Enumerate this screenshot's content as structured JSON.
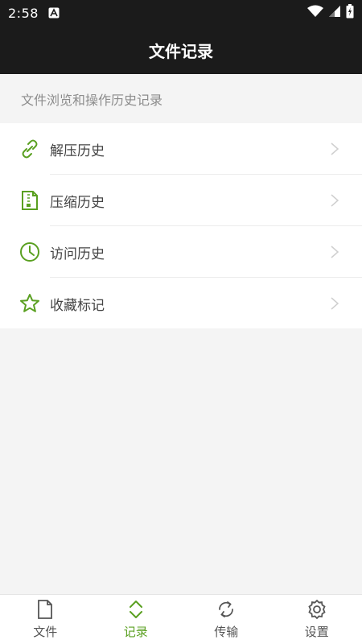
{
  "status_bar": {
    "time": "2:58",
    "notification_icon": "notification-a-icon",
    "wifi_icon": "wifi-icon",
    "signal_icon": "signal-icon",
    "battery_icon": "battery-icon"
  },
  "header": {
    "title": "文件记录"
  },
  "subtitle": "文件浏览和操作历史记录",
  "menu": {
    "items": [
      {
        "label": "解压历史",
        "icon": "unlink-icon"
      },
      {
        "label": "压缩历史",
        "icon": "zip-file-icon"
      },
      {
        "label": "访问历史",
        "icon": "clock-icon"
      },
      {
        "label": "收藏标记",
        "icon": "star-icon"
      }
    ]
  },
  "tabs": [
    {
      "label": "文件",
      "icon": "file-icon",
      "active": false
    },
    {
      "label": "记录",
      "icon": "expand-arrows-icon",
      "active": true
    },
    {
      "label": "传输",
      "icon": "sync-icon",
      "active": false
    },
    {
      "label": "设置",
      "icon": "gear-icon",
      "active": false
    }
  ],
  "colors": {
    "accent": "#5aa021",
    "bar": "#1b1b1b",
    "background": "#f4f4f4"
  }
}
